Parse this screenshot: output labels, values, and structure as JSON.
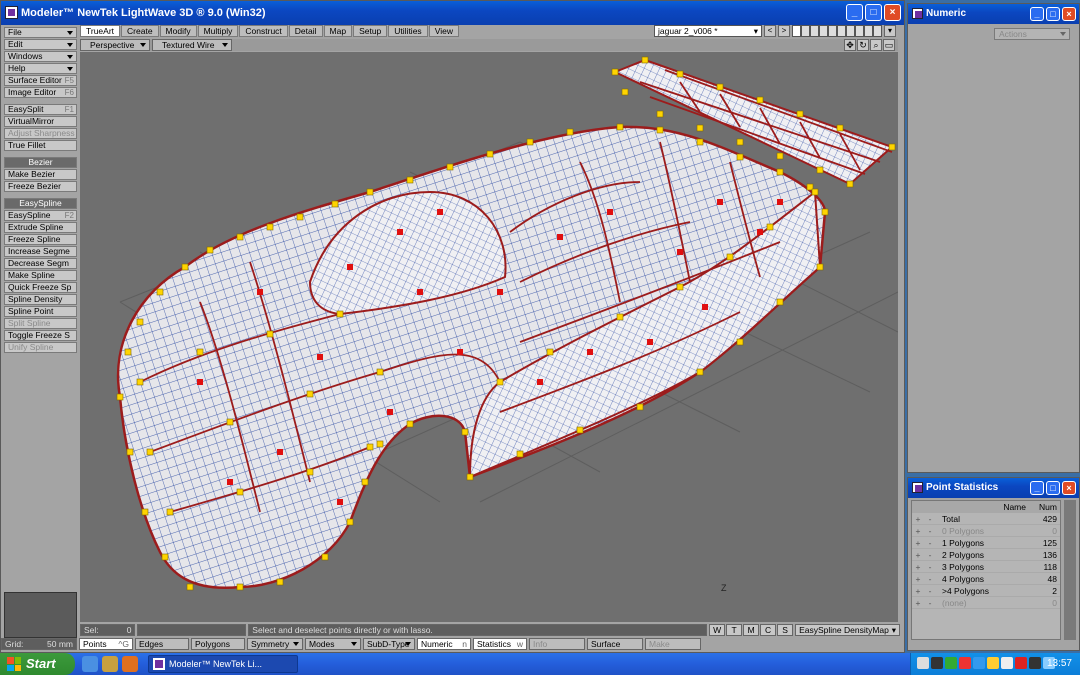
{
  "window": {
    "title": "Modeler™ NewTek LightWave 3D ® 9.0 (Win32)"
  },
  "menu": {
    "top": [
      {
        "label": "File"
      },
      {
        "label": "Edit"
      },
      {
        "label": "Windows"
      },
      {
        "label": "Help"
      }
    ],
    "editors": [
      {
        "label": "Surface Editor",
        "key": "F5"
      },
      {
        "label": "Image Editor",
        "key": "F6"
      }
    ],
    "tools1": [
      {
        "label": "EasySplit",
        "key": "F1",
        "dim": false
      },
      {
        "label": "VirtualMirror",
        "dim": false
      },
      {
        "label": "Adjust Sharpness",
        "dim": true
      },
      {
        "label": "True Fillet",
        "dim": false
      }
    ],
    "bezier_header": "Bezier",
    "bezier": [
      {
        "label": "Make Bezier"
      },
      {
        "label": "Freeze Bezier"
      }
    ],
    "easyspline_header": "EasySpline",
    "easyspline": [
      {
        "label": "EasySpline",
        "key": "F2",
        "dim": false
      },
      {
        "label": "Extrude Spline",
        "dim": false
      },
      {
        "label": "Freeze Spline",
        "dim": false
      },
      {
        "label": "Increase Segme",
        "dim": false
      },
      {
        "label": "Decrease Segm",
        "dim": false
      },
      {
        "label": "Make Spline",
        "dim": false
      },
      {
        "label": "Quick Freeze Sp",
        "dim": false
      },
      {
        "label": "Spline Density",
        "dim": false
      },
      {
        "label": "Spline Point",
        "dim": false
      },
      {
        "label": "Split Spline",
        "dim": true
      },
      {
        "label": "Toggle Freeze S",
        "dim": false
      },
      {
        "label": "Unify Spline",
        "dim": true
      }
    ]
  },
  "tabs": [
    {
      "label": "TrueArt",
      "active": true
    },
    {
      "label": "Create"
    },
    {
      "label": "Modify"
    },
    {
      "label": "Multiply"
    },
    {
      "label": "Construct"
    },
    {
      "label": "Detail"
    },
    {
      "label": "Map"
    },
    {
      "label": "Setup"
    },
    {
      "label": "Utilities"
    },
    {
      "label": "View"
    }
  ],
  "object_selector": {
    "value": "jaguar 2_v006 *"
  },
  "viewport": {
    "view": "Perspective",
    "render": "Textured Wire",
    "axis_label": "Z"
  },
  "status": {
    "sel_label": "Sel:",
    "sel_value": "0",
    "hint": "Select and deselect points directly or with lasso.",
    "wtmcs": [
      "W",
      "T",
      "M",
      "C",
      "S"
    ],
    "map": "EasySpline DensityMap"
  },
  "bottom": {
    "grid_label": "Grid:",
    "grid_value": "50 mm",
    "points": "Points",
    "points_key": "^G",
    "edges": "Edges",
    "polygons": "Polygons",
    "symmetry": "Symmetry",
    "modes": "Modes",
    "subd": "SubD-Type",
    "numeric": "Numeric",
    "numeric_key": "n",
    "statistics": "Statistics",
    "statistics_key": "w",
    "info": "Info",
    "surface": "Surface",
    "make": "Make"
  },
  "numeric_panel": {
    "title": "Numeric",
    "actions": "Actions"
  },
  "point_stats": {
    "title": "Point Statistics",
    "col_name": "Name",
    "col_num": "Num",
    "rows": [
      {
        "name": "Total",
        "num": "429",
        "dim": false
      },
      {
        "name": "0 Polygons",
        "num": "0",
        "dim": true
      },
      {
        "name": "1 Polygons",
        "num": "125",
        "dim": false
      },
      {
        "name": "2 Polygons",
        "num": "136",
        "dim": false
      },
      {
        "name": "3 Polygons",
        "num": "118",
        "dim": false
      },
      {
        "name": "4 Polygons",
        "num": "48",
        "dim": false
      },
      {
        "name": ">4 Polygons",
        "num": "2",
        "dim": false
      },
      {
        "name": "(none)",
        "num": "0",
        "dim": true
      }
    ]
  },
  "taskbar": {
    "start": "Start",
    "task": "Modeler™ NewTek Li...",
    "clock": "13:57"
  },
  "colors": {
    "accent": "#0a5fd8",
    "wire": "#1c3c9c",
    "edge": "#9c1c1c",
    "point": "#ffd400"
  }
}
